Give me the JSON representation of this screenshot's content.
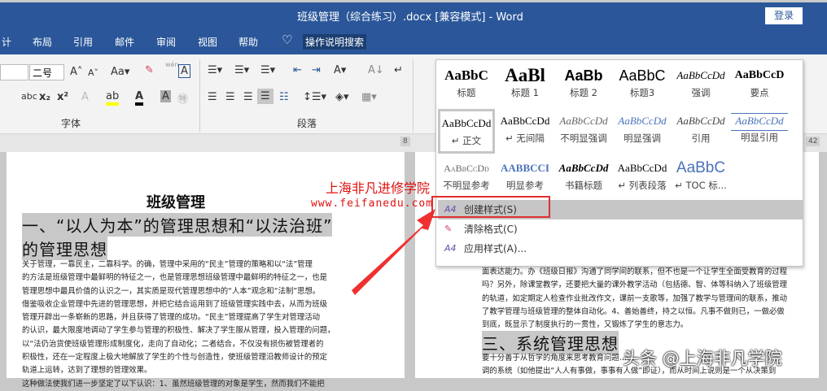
{
  "titlebar": {
    "title": "班级管理（综合练习）.docx [兼容模式] - Word",
    "login": "登录"
  },
  "tabs": [
    "计",
    "布局",
    "引用",
    "邮件",
    "审阅",
    "视图",
    "帮助"
  ],
  "tell_me": "操作说明搜索",
  "ribbon": {
    "font_size": "二号",
    "font_group": "字体",
    "paragraph_group": "段落",
    "phonetic": "wén"
  },
  "ruler": {
    "left": "8",
    "right": "42"
  },
  "doc": {
    "title": "班级管理",
    "h1_line1": "一、“以人为本”的管理思想和“以法治班”",
    "h1_line2": "的管理思想",
    "left_lines": [
      "关于管理，一靠民主，二靠科学。的确，管理中采用的“民主”管理的策略和以“法”管理",
      "的方法是班级管理中最鲜明的特征之一，也是管理思想班级管理中最鲜明的特征之一，也是",
      "管理思想中最具价值的认识之一，其实质是现代管理思想中的“人本”观念和“法制”思想。",
      "借鉴吸收企业管理中先进的管理思想，并把它结合运用到了班级管理实践中去，从而为班级",
      "管理开辟出一条崭新的思路，并且获得了管理的成功。“民主”管理提高了学生对管理活动",
      "的认识，最大限度地调动了学生参与管理的积极性、解决了学生服从管理，投入管理的问题，",
      "以“法仍治货使班级管理形成制度化，走向了自动化；二者结合，不仅没有损伤被管理者的",
      "积极性，还在一定程度上极大地解放了学生的个性与创造性，使班级管理沿教师设计的预定",
      "轨道上运转，达到了理想的管理效果。",
      "这种做法使我们进一步坚定了以下认识：1、虽然班级管理的对象是学生，然而我们不能把"
    ],
    "right_lines": [
      "面表达能力。办《班级日报》沟通了同学间的联系，但不也是一个让学生全面受教育的过程",
      "吗？另外，除课堂教学，还要把大量的课外教学活动（包括德、智、体等科纳入了班级管理",
      "的轨道，如定期定人检查作业批改作文，课前一支歌等，加强了教学与管理间的联系，推动",
      "了教学管理与班级管理的整体自动化。4、善始善终，持之以恒。凡事不做则已，一做必做",
      "到底，既显示了制度执行的一贯性，又锻炼了学生的意志力。"
    ],
    "h3": "三、系统管理思想",
    "right_lines2": [
      "要十分善于从哲学的角度来思考教育问题……",
      "调的系统（如他提出“人人有事做，事事有人做”即证），而从时间上说则是一个从决策到"
    ]
  },
  "watermarks": {
    "school": "上海非凡进修学院",
    "url": "www.feifanedu.com.cn",
    "toutiao": "头条 @上海非凡学院"
  },
  "styles": [
    {
      "sample": "AaBbC",
      "label": "标题"
    },
    {
      "sample": "AaBl",
      "label": "标题 1"
    },
    {
      "sample": "AaBb",
      "label": "标题 2"
    },
    {
      "sample": "AaBbC",
      "label": "标题3"
    },
    {
      "sample": "AaBbCcDd",
      "label": "强调"
    },
    {
      "sample": "AaBbCcD",
      "label": "要点"
    },
    {
      "sample": "AaBbCcDd",
      "label": "↵ 正文"
    },
    {
      "sample": "AaBbCcDd",
      "label": "↵ 无间隔"
    },
    {
      "sample": "AaBbCcDd",
      "label": "不明显强调"
    },
    {
      "sample": "AaBbCcDd",
      "label": "明显强调"
    },
    {
      "sample": "AaBbCcDd",
      "label": "引用"
    },
    {
      "sample": "AaBbCcDd",
      "label": "明显引用"
    },
    {
      "sample": "AaBbCcDd",
      "label": "不明显参考"
    },
    {
      "sample": "AABBCCI",
      "label": "明显参考"
    },
    {
      "sample": "AaBbCcDd",
      "label": "书籍标题"
    },
    {
      "sample": "AaBbCcDd",
      "label": "↵ 列表段落"
    },
    {
      "sample": "AaBbC",
      "label": "↵ TOC 标..."
    }
  ],
  "menu": {
    "create": "创建样式(S)",
    "clear": "清除格式(C)",
    "apply": "应用样式(A)..."
  },
  "colors": {
    "brand": "#2b579a",
    "annotation": "#e03030"
  }
}
